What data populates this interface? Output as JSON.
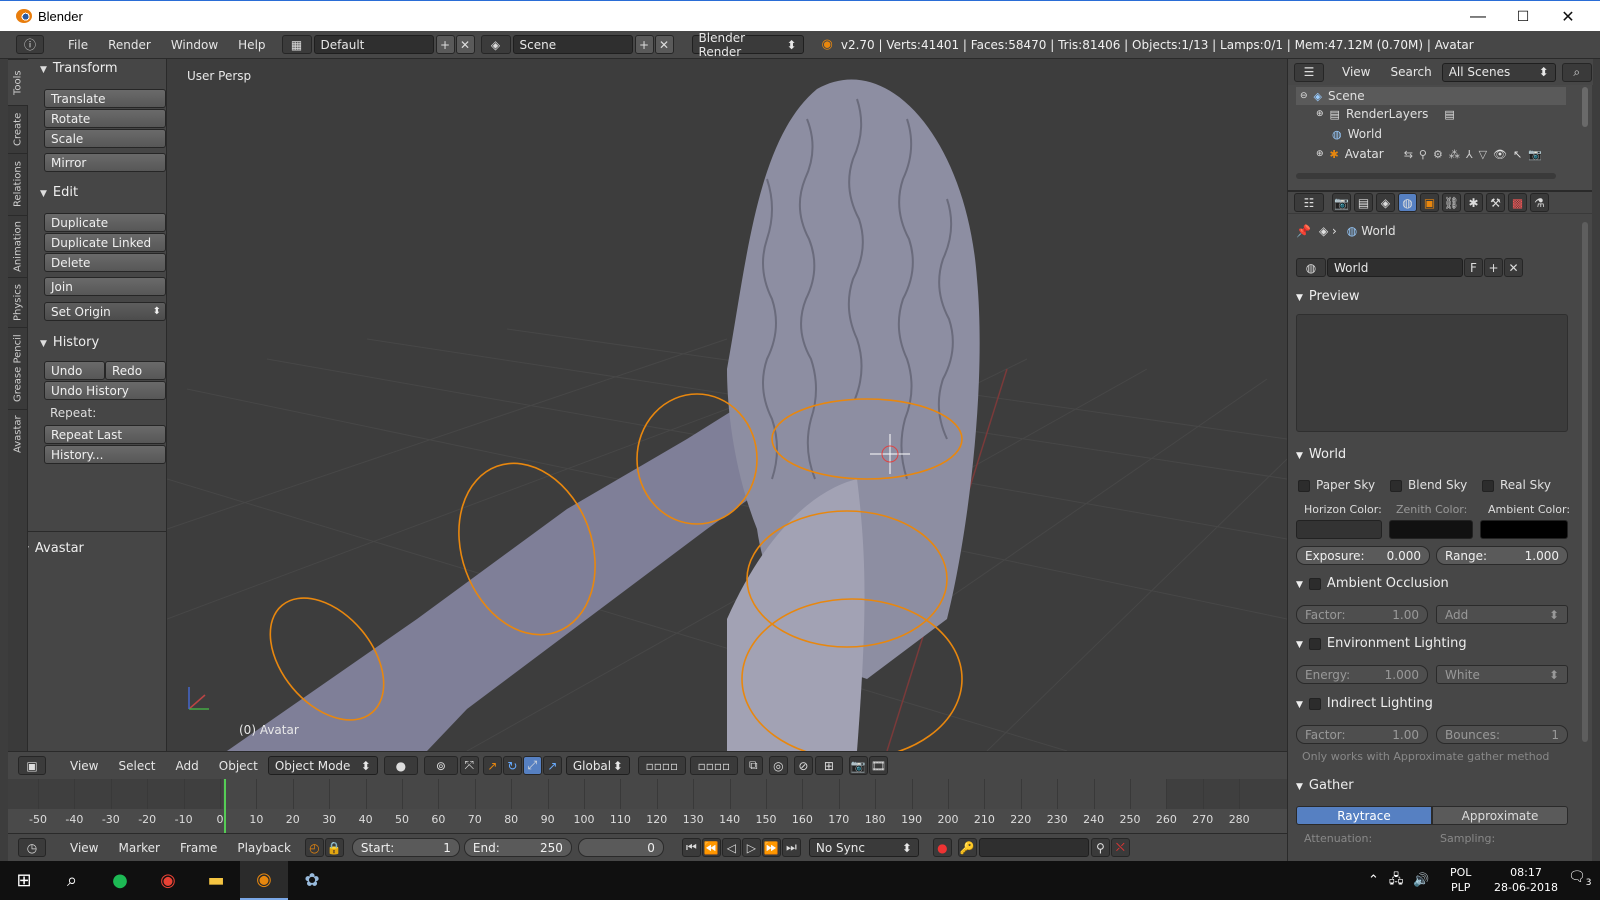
{
  "window": {
    "title": "Blender",
    "minimize": "—",
    "maximize": "☐",
    "close": "✕"
  },
  "topbar": {
    "menus": [
      "File",
      "Render",
      "Window",
      "Help"
    ],
    "screen_layout": "Default",
    "scene": "Scene",
    "render_engine": "Blender Render",
    "info": "v2.70 | Verts:41401 | Faces:58470 | Tris:81406 | Objects:1/13 | Lamps:0/1 | Mem:47.12M (0.70M) | Avatar"
  },
  "toolshelf": {
    "tabs": [
      "Tools",
      "Create",
      "Relations",
      "Animation",
      "Physics",
      "Grease Pencil",
      "Avastar"
    ],
    "transform_title": "Transform",
    "translate": "Translate",
    "rotate": "Rotate",
    "scale": "Scale",
    "mirror": "Mirror",
    "edit_title": "Edit",
    "duplicate": "Duplicate",
    "duplicate_linked": "Duplicate Linked",
    "delete": "Delete",
    "join": "Join",
    "set_origin": "Set Origin",
    "history_title": "History",
    "undo": "Undo",
    "redo": "Redo",
    "undo_history": "Undo History",
    "repeat_label": "Repeat:",
    "repeat_last": "Repeat Last",
    "history_more": "History...",
    "avastar_title": "Avastar"
  },
  "viewport": {
    "view_label": "User Persp",
    "object_label": "(0) Avatar"
  },
  "view3d_header": {
    "menus": [
      "View",
      "Select",
      "Add",
      "Object"
    ],
    "mode": "Object Mode",
    "orientation": "Global"
  },
  "timeline": {
    "ticks": [
      "-50",
      "-40",
      "-30",
      "-20",
      "-10",
      "0",
      "10",
      "20",
      "30",
      "40",
      "50",
      "60",
      "70",
      "80",
      "90",
      "100",
      "110",
      "120",
      "130",
      "140",
      "150",
      "160",
      "170",
      "180",
      "190",
      "200",
      "210",
      "220",
      "230",
      "240",
      "250",
      "260",
      "270",
      "280"
    ],
    "menus": [
      "View",
      "Marker",
      "Frame",
      "Playback"
    ],
    "start_label": "Start:",
    "start": "1",
    "end_label": "End:",
    "end": "250",
    "current": "0",
    "sync": "No Sync"
  },
  "outliner": {
    "menus": [
      "View",
      "Search"
    ],
    "filter": "All Scenes",
    "items": [
      "Scene",
      "RenderLayers",
      "World",
      "Avatar"
    ]
  },
  "properties": {
    "breadcrumb": "World",
    "world_name": "World",
    "fake_user": "F",
    "preview_title": "Preview",
    "world_title": "World",
    "paper_sky": "Paper Sky",
    "blend_sky": "Blend Sky",
    "real_sky": "Real Sky",
    "horizon_color": "Horizon Color:",
    "zenith_color": "Zenith Color:",
    "ambient_color": "Ambient Color:",
    "exposure_label": "Exposure:",
    "exposure": "0.000",
    "range_label": "Range:",
    "range": "1.000",
    "ao_title": "Ambient Occlusion",
    "factor_label": "Factor:",
    "ao_factor": "1.00",
    "ao_blend": "Add",
    "env_title": "Environment Lighting",
    "energy_label": "Energy:",
    "energy": "1.000",
    "env_color": "White",
    "indirect_title": "Indirect Lighting",
    "ind_factor": "1.00",
    "bounces_label": "Bounces:",
    "bounces": "1",
    "note": "Only works with Approximate gather method",
    "gather_title": "Gather",
    "raytrace": "Raytrace",
    "approximate": "Approximate",
    "sub_attenuation": "Attenuation:",
    "sub_sampling": "Sampling:"
  },
  "taskbar": {
    "lang_top": "POL",
    "lang_bottom": "PLP",
    "time": "08:17",
    "date": "28-06-2018",
    "notifications": "3"
  },
  "colors": {
    "accent_orange": "#e8870e",
    "selection_blue": "#5680c2"
  }
}
